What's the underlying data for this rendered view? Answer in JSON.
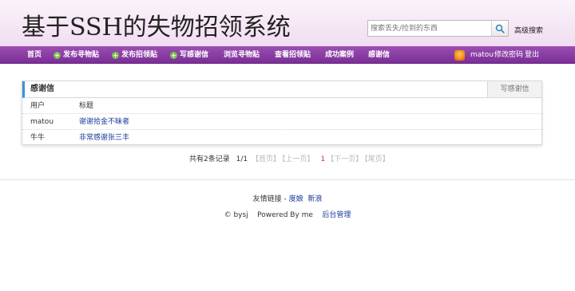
{
  "header": {
    "site_title": "基于SSH的失物招领系统",
    "search_placeholder": "搜索丢失/捡到的东西",
    "advanced_search": "高级搜索"
  },
  "nav": {
    "home": "首页",
    "post_lost": "发布寻物贴",
    "post_found": "发布招领贴",
    "write_thanks": "写感谢信",
    "browse_lost": "浏览寻物贴",
    "browse_found": "查看招领贴",
    "success_cases": "成功案例",
    "thanks_letters": "感谢信",
    "username": "matou",
    "change_password": "修改密码",
    "logout": "登出"
  },
  "panel": {
    "title": "感谢信",
    "write_button": "写感谢信",
    "columns": {
      "user": "用户",
      "title": "标题"
    },
    "rows": [
      {
        "user": "matou",
        "title": "谢谢拾金不昧者"
      },
      {
        "user": "牛牛",
        "title": "非常感谢张三丰"
      }
    ]
  },
  "pager": {
    "total": "共有2条记录",
    "page_info": "1/1",
    "first": "【首页】",
    "prev": "【上一页】",
    "current": "1",
    "next": "【下一页】",
    "last": "【尾页】"
  },
  "footer": {
    "friend_links_label": "友情链接 - ",
    "link_baidu": "度娘",
    "link_sina": "新浪",
    "copyright": "© bysj",
    "powered": "Powered By me",
    "admin": "后台管理"
  },
  "colors": {
    "nav_bg": "#8a3fa5",
    "header_bg": "#f4e4f4",
    "panel_accent": "#3f93d4",
    "link": "#1a3a9a",
    "current_page": "#c0392b"
  }
}
